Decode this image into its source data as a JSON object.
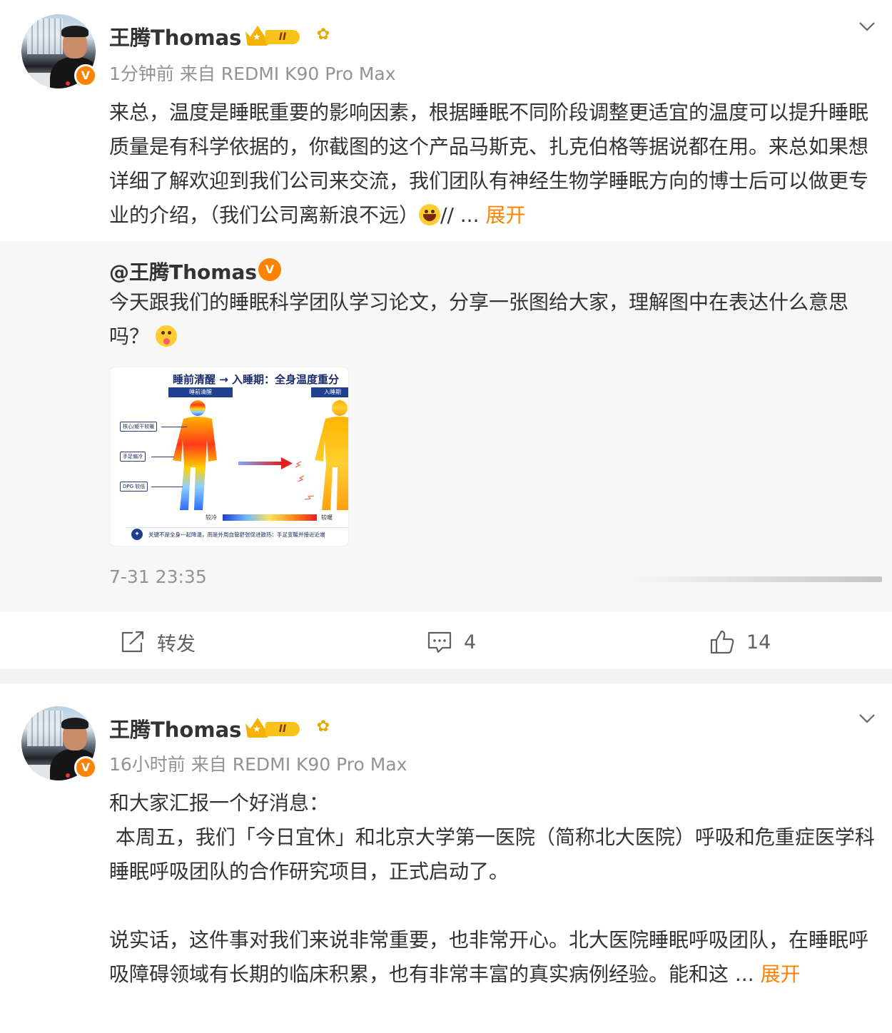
{
  "posts": [
    {
      "username": "王腾Thomas",
      "level": "II",
      "meta": "1分钟前  来自 REDMI K90 Pro Max",
      "content_text": "来总，温度是睡眠重要的影响因素，根据睡眠不同阶段调整更适宜的温度可以提升睡眠质量是有科学依据的，你截图的这个产品马斯克、扎克伯格等据说都在用。来总如果想详细了解欢迎到我们公司来交流，我们团队有神经生物学睡眠方向的博士后可以做更专业的介绍，（我们公司离新浪不远）",
      "content_after_emoji": "// ... ",
      "expand_label": "展开",
      "repost": {
        "username": "@王腾Thomas",
        "text_line": "今天跟我们的睡眠科学团队学习论文，分享一张图给大家，理解图中在表达什么意思吗？",
        "image": {
          "title": "睡前清醒 → 入睡期：全身温度重分",
          "tag_left": "睡前清醒",
          "tag_right": "入睡期",
          "label_core": "核心/躯干较暖",
          "label_limbs": "手足偏冷",
          "label_dpg": "DPG 较低",
          "scale_cold": "较冷",
          "scale_warm": "较暖",
          "footer": "关键不是全身一起降温，而是外周血管舒张促进散热：手足变暖并接近近端"
        },
        "time": "7-31 23:35"
      },
      "actions": {
        "repost_label": "转发",
        "comment_count": "4",
        "like_count": "14"
      }
    },
    {
      "username": "王腾Thomas",
      "level": "II",
      "meta": "16小时前  来自 REDMI K90 Pro Max",
      "para1": "和大家汇报一个好消息：",
      "para2": " 本周五，我们「今日宜休」和北京大学第一医院（简称北大医院）呼吸和危重症医学科睡眠呼吸团队的合作研究项目，正式启动了。",
      "para3": "说实话，这件事对我们来说非常重要，也非常开心。北大医院睡眠呼吸团队，在睡眠呼吸障碍领域有长期的临床积累，也有非常丰富的真实病例经验。能和这  ... ",
      "expand_label": "展开"
    }
  ],
  "colors": {
    "accent": "#ff8200",
    "meta_gray": "#939393",
    "separator": "#f2f2f2",
    "repost_bg": "#f7f7f7"
  },
  "icons": [
    "chevron-down-icon",
    "verified-badge-icon",
    "crown-level-icon",
    "sunflower-icon",
    "repost-icon",
    "comment-icon",
    "like-icon"
  ]
}
